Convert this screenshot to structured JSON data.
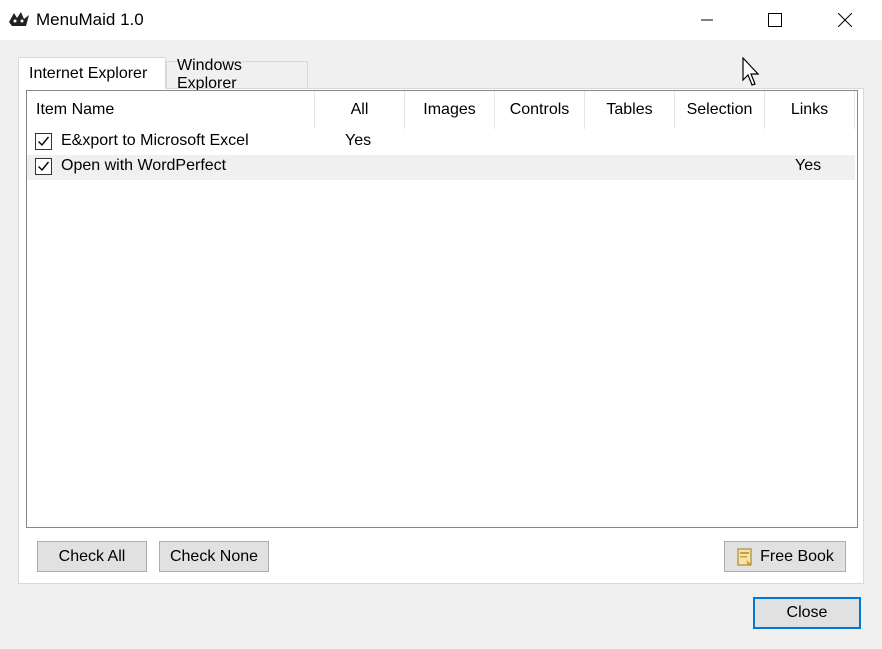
{
  "window": {
    "title": "MenuMaid 1.0",
    "controls": {
      "minimize": "minimize-icon",
      "maximize": "maximize-icon",
      "close": "close-icon"
    }
  },
  "tabs": [
    {
      "label": "Internet Explorer",
      "active": true
    },
    {
      "label": "Windows Explorer",
      "active": false
    }
  ],
  "list": {
    "columns": [
      "Item Name",
      "All",
      "Images",
      "Controls",
      "Tables",
      "Selection",
      "Links"
    ],
    "rows": [
      {
        "checked": true,
        "name": "E&xport to Microsoft Excel",
        "all": "Yes",
        "images": "",
        "controls": "",
        "tables": "",
        "selection": "",
        "links": ""
      },
      {
        "checked": true,
        "name": "Open with WordPerfect",
        "all": "",
        "images": "",
        "controls": "",
        "tables": "",
        "selection": "",
        "links": "Yes"
      }
    ]
  },
  "buttons": {
    "check_all": "Check All",
    "check_none": "Check None",
    "free_book": "Free Book",
    "close": "Close"
  },
  "colors": {
    "focus_border": "#0078d7",
    "button_face": "#e1e1e1",
    "alt_row": "#f0f0f0"
  }
}
